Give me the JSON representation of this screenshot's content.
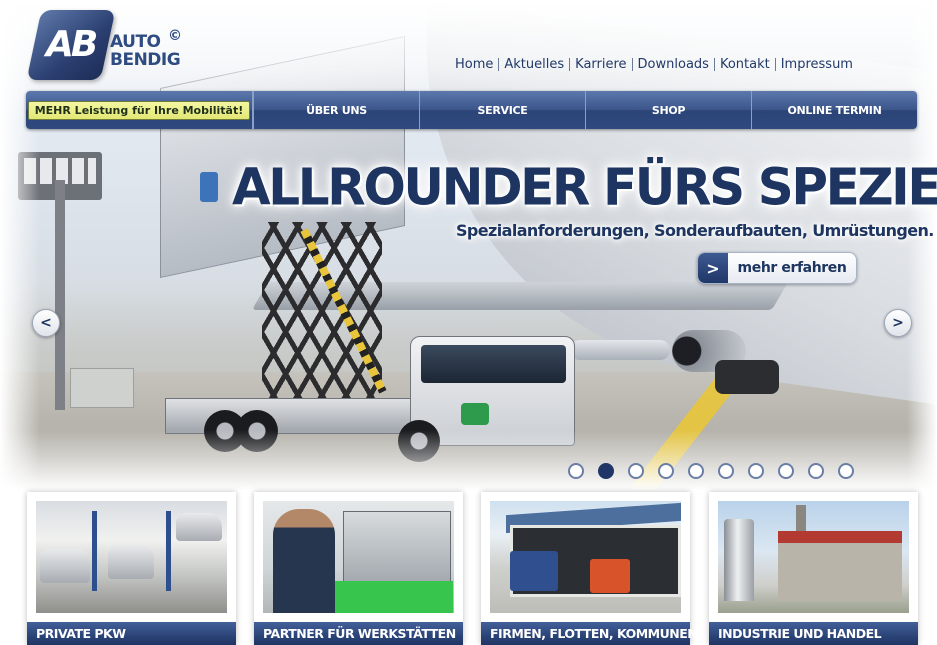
{
  "brand": {
    "mono": "AB",
    "line1": "AUTO",
    "line2": "BENDIG",
    "copyright": "©"
  },
  "topnav": [
    "Home",
    "Aktuelles",
    "Karriere",
    "Downloads",
    "Kontakt",
    "Impressum"
  ],
  "mainnav": {
    "promo": "MEHR Leistung für Ihre Mobilität!",
    "items": [
      "ÜBER UNS",
      "SERVICE",
      "SHOP",
      "ONLINE TERMIN"
    ]
  },
  "hero": {
    "headline": "ALLROUNDER FÜRS SPEZIELLE",
    "subline": "Spezialanforderungen, Sonderaufbauten, Umrüstungen.",
    "cta_icon": "chevron-right-icon",
    "cta_label": "mehr erfahren",
    "prev_icon": "chevron-left-icon",
    "next_icon": "chevron-right-icon"
  },
  "slider": {
    "total": 10,
    "active": 2
  },
  "tiles": [
    {
      "caption": "PRIVATE PKW"
    },
    {
      "caption": "PARTNER FÜR WERKSTÄTTEN"
    },
    {
      "caption": "FIRMEN, FLOTTEN, KOMMUNEN"
    },
    {
      "caption": "INDUSTRIE UND HANDEL"
    }
  ],
  "colors": {
    "brand_navy": "#1d3560",
    "nav_blue": "#2f4a80",
    "promo_yellow": "#e2e774"
  }
}
